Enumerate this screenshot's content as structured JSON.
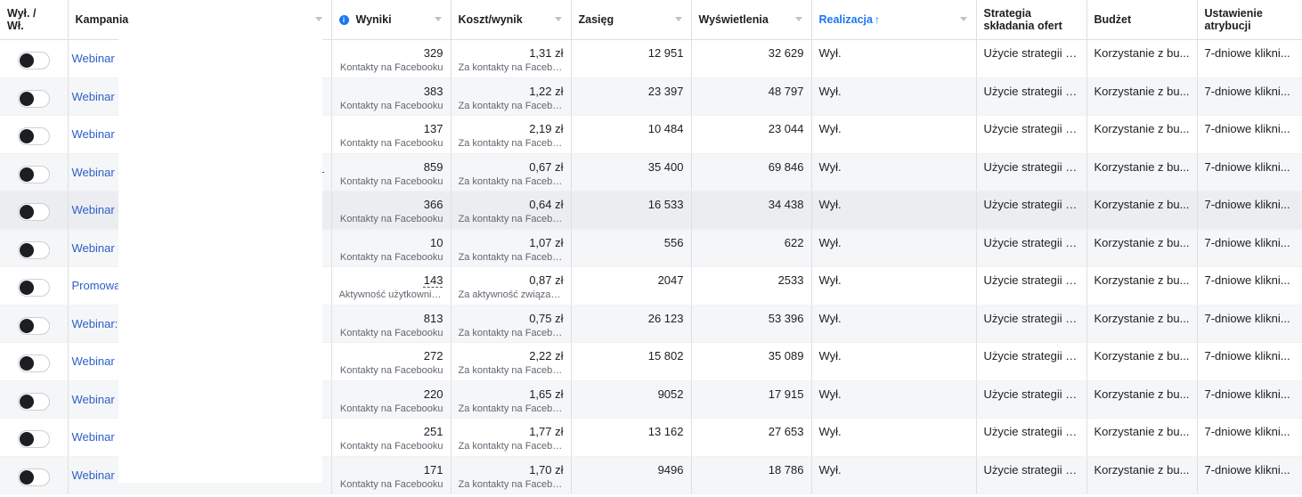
{
  "headers": {
    "onoff": "Wył. /\nWł.",
    "campaign": "Kampania",
    "results": "Wyniki",
    "cost": "Koszt/wynik",
    "reach": "Zasięg",
    "impressions": "Wyświetlenia",
    "delivery": "Realizacja",
    "bid_strategy": "Strategia\nskładania ofert",
    "budget": "Budżet",
    "attribution": "Ustawienie\natrybucji"
  },
  "icons": {
    "info": "info-icon",
    "sort_up": "arrow-up-icon",
    "caret": "chevron-down-icon"
  },
  "colors": {
    "accent": "#1877f2",
    "link": "#2e5ec9"
  },
  "rows": [
    {
      "campaign": "Webinar -",
      "results": "329",
      "results_type": "Kontakty na Facebooku",
      "cost": "1,31 zł",
      "cost_type": "Za kontakty na Facebo...",
      "reach": "12 951",
      "impressions": "32 629",
      "delivery": "Wył.",
      "bid": "Użycie strategii s...",
      "budget": "Korzystanie z bu...",
      "attribution": "7-dniowe klikni..."
    },
    {
      "campaign": "Webinar -",
      "results": "383",
      "results_type": "Kontakty na Facebooku",
      "cost": "1,22 zł",
      "cost_type": "Za kontakty na Facebo...",
      "reach": "23 397",
      "impressions": "48 797",
      "delivery": "Wył.",
      "bid": "Użycie strategii s...",
      "budget": "Korzystanie z bu...",
      "attribution": "7-dniowe klikni..."
    },
    {
      "campaign": "Webinar -",
      "results": "137",
      "results_type": "Kontakty na Facebooku",
      "cost": "2,19 zł",
      "cost_type": "Za kontakty na Facebo...",
      "reach": "10 484",
      "impressions": "23 044",
      "delivery": "Wył.",
      "bid": "Użycie strategii s...",
      "budget": "Korzystanie z bu...",
      "attribution": "7-dniowe klikni..."
    },
    {
      "campaign": "Webinar -",
      "results": "859",
      "results_type": "Kontakty na Facebooku",
      "cost": "0,67 zł",
      "cost_type": "Za kontakty na Facebo...",
      "reach": "35 400",
      "impressions": "69 846",
      "delivery": "Wył.",
      "bid": "Użycie strategii s...",
      "budget": "Korzystanie z bu...",
      "attribution": "7-dniowe klikni..."
    },
    {
      "campaign": "Webinar -",
      "results": "366",
      "results_type": "Kontakty na Facebooku",
      "cost": "0,64 zł",
      "cost_type": "Za kontakty na Facebo...",
      "reach": "16 533",
      "impressions": "34 438",
      "delivery": "Wył.",
      "bid": "Użycie strategii s...",
      "budget": "Korzystanie z bu...",
      "attribution": "7-dniowe klikni..."
    },
    {
      "campaign": "Webinar -",
      "results": "10",
      "results_type": "Kontakty na Facebooku",
      "cost": "1,07 zł",
      "cost_type": "Za kontakty na Facebo...",
      "reach": "556",
      "impressions": "622",
      "delivery": "Wył.",
      "bid": "Użycie strategii s...",
      "budget": "Korzystanie z bu...",
      "attribution": "7-dniowe klikni..."
    },
    {
      "campaign": "Promowa",
      "results": "143",
      "results_type": "Aktywność użytkownik...",
      "cost": "0,87 zł",
      "cost_type": "Za aktywność związan...",
      "reach": "2047",
      "impressions": "2533",
      "delivery": "Wył.",
      "bid": "Użycie strategii s...",
      "budget": "Korzystanie z bu...",
      "attribution": "7-dniowe klikni..."
    },
    {
      "campaign": "Webinar:",
      "results": "813",
      "results_type": "Kontakty na Facebooku",
      "cost": "0,75 zł",
      "cost_type": "Za kontakty na Facebo...",
      "reach": "26 123",
      "impressions": "53 396",
      "delivery": "Wył.",
      "bid": "Użycie strategii s...",
      "budget": "Korzystanie z bu...",
      "attribution": "7-dniowe klikni..."
    },
    {
      "campaign": "Webinar -",
      "results": "272",
      "results_type": "Kontakty na Facebooku",
      "cost": "2,22 zł",
      "cost_type": "Za kontakty na Facebo...",
      "reach": "15 802",
      "impressions": "35 089",
      "delivery": "Wył.",
      "bid": "Użycie strategii s...",
      "budget": "Korzystanie z bu...",
      "attribution": "7-dniowe klikni..."
    },
    {
      "campaign": "Webinar -",
      "results": "220",
      "results_type": "Kontakty na Facebooku",
      "cost": "1,65 zł",
      "cost_type": "Za kontakty na Facebo...",
      "reach": "9052",
      "impressions": "17 915",
      "delivery": "Wył.",
      "bid": "Użycie strategii s...",
      "budget": "Korzystanie z bu...",
      "attribution": "7-dniowe klikni..."
    },
    {
      "campaign": "Webinar -",
      "results": "251",
      "results_type": "Kontakty na Facebooku",
      "cost": "1,77 zł",
      "cost_type": "Za kontakty na Facebo...",
      "reach": "13 162",
      "impressions": "27 653",
      "delivery": "Wył.",
      "bid": "Użycie strategii s...",
      "budget": "Korzystanie z bu...",
      "attribution": "7-dniowe klikni..."
    },
    {
      "campaign": "Webinar -",
      "results": "171",
      "results_type": "Kontakty na Facebooku",
      "cost": "1,70 zł",
      "cost_type": "Za kontakty na Facebo...",
      "reach": "9496",
      "impressions": "18 786",
      "delivery": "Wył.",
      "bid": "Użycie strategii s...",
      "budget": "Korzystanie z bu...",
      "attribution": "7-dniowe klikni..."
    }
  ]
}
